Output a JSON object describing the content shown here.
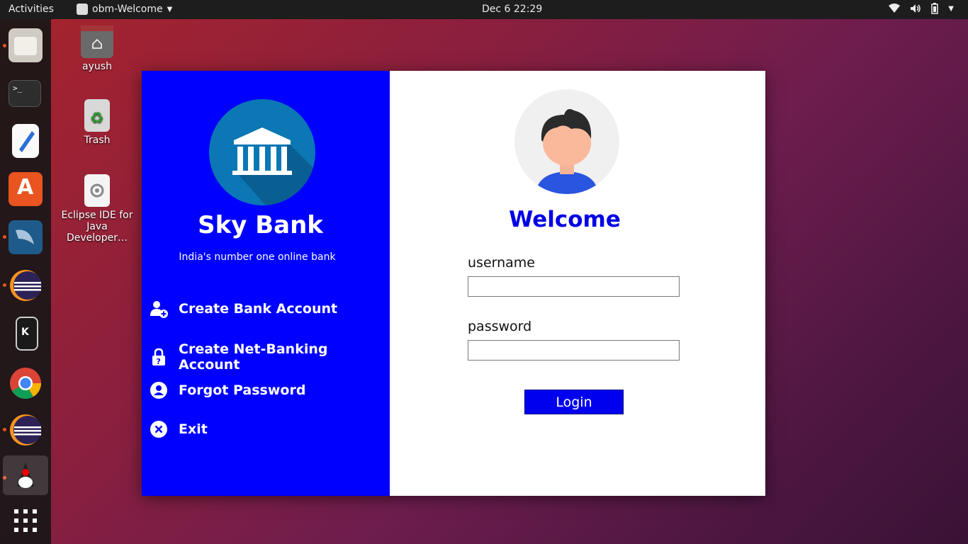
{
  "topbar": {
    "activities": "Activities",
    "app_name": "obm-Welcome",
    "clock": "Dec 6  22:29"
  },
  "desktop": {
    "icons": [
      {
        "label": "ayush",
        "icon": "home-folder-icon"
      },
      {
        "label": "Trash",
        "icon": "trash-icon"
      },
      {
        "label_line1": "Eclipse IDE for",
        "label_line2": "Java Developer…",
        "icon": "eclipse-launcher-icon"
      }
    ]
  },
  "dock": {
    "items": [
      "files",
      "terminal",
      "text-editor",
      "software-center",
      "mysql-workbench",
      "eclipse",
      "kde-connect",
      "chrome",
      "eclipse-2",
      "java-app",
      "show-applications"
    ]
  },
  "sidebar": {
    "bank_name": "Sky Bank",
    "tagline": "India's number one online bank",
    "menu": [
      {
        "label": "Create Bank Account",
        "icon": "add-user-icon"
      },
      {
        "label": "Create Net-Banking Account",
        "icon": "lock-question-icon"
      },
      {
        "label": "Forgot Password",
        "icon": "user-circle-icon"
      },
      {
        "label": "Exit",
        "icon": "close-circle-icon"
      }
    ]
  },
  "login": {
    "welcome": "Welcome",
    "username_label": "username",
    "username_value": "",
    "password_label": "password",
    "password_value": "",
    "button": "Login"
  },
  "colors": {
    "sidebar_bg": "#0000ff",
    "welcome_text": "#0000e6",
    "bank_circle": "#0b77b4"
  }
}
